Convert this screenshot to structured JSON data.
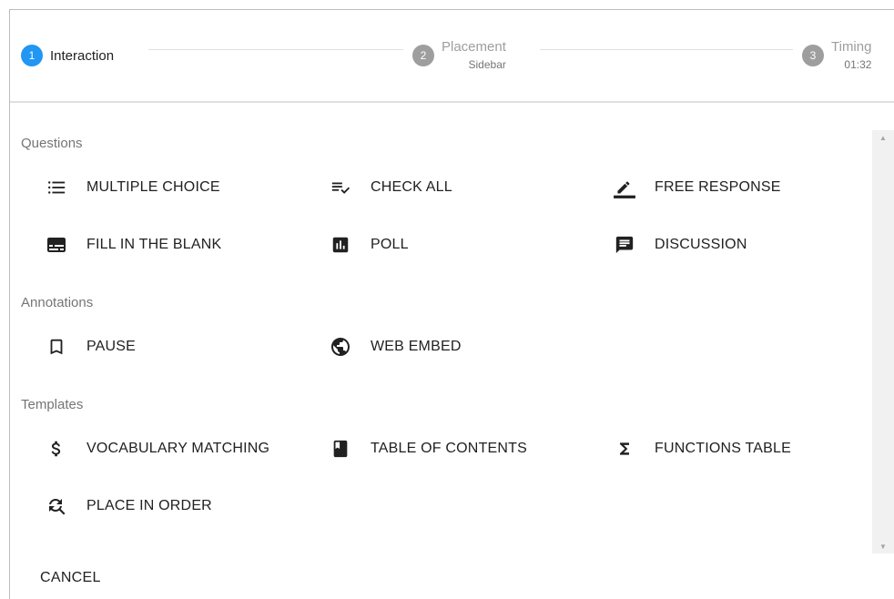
{
  "stepper": {
    "steps": [
      {
        "number": "1",
        "label": "Interaction",
        "state": "active"
      },
      {
        "number": "2",
        "label": "Placement",
        "sub": "Sidebar",
        "state": "inactive"
      },
      {
        "number": "3",
        "label": "Timing",
        "sub": "01:32",
        "state": "inactive"
      }
    ]
  },
  "sections": {
    "questions": {
      "title": "Questions",
      "items": [
        {
          "label": "MULTIPLE CHOICE",
          "icon": "list-icon"
        },
        {
          "label": "CHECK ALL",
          "icon": "playlist-check-icon"
        },
        {
          "label": "FREE RESPONSE",
          "icon": "pencil-icon"
        },
        {
          "label": "FILL IN THE BLANK",
          "icon": "subtitles-icon"
        },
        {
          "label": "POLL",
          "icon": "poll-icon"
        },
        {
          "label": "DISCUSSION",
          "icon": "comment-icon"
        }
      ]
    },
    "annotations": {
      "title": "Annotations",
      "items": [
        {
          "label": "PAUSE",
          "icon": "bookmark-icon"
        },
        {
          "label": "WEB EMBED",
          "icon": "globe-icon"
        }
      ]
    },
    "templates": {
      "title": "Templates",
      "items": [
        {
          "label": "VOCABULARY MATCHING",
          "icon": "dollar-icon"
        },
        {
          "label": "TABLE OF CONTENTS",
          "icon": "book-icon"
        },
        {
          "label": "FUNCTIONS TABLE",
          "icon": "sigma-icon"
        },
        {
          "label": "PLACE IN ORDER",
          "icon": "find-replace-icon"
        }
      ]
    }
  },
  "footer": {
    "cancel_label": "CANCEL"
  },
  "colors": {
    "accent": "#2196f3",
    "inactive_step": "#9e9e9e",
    "muted_text": "#757575"
  }
}
